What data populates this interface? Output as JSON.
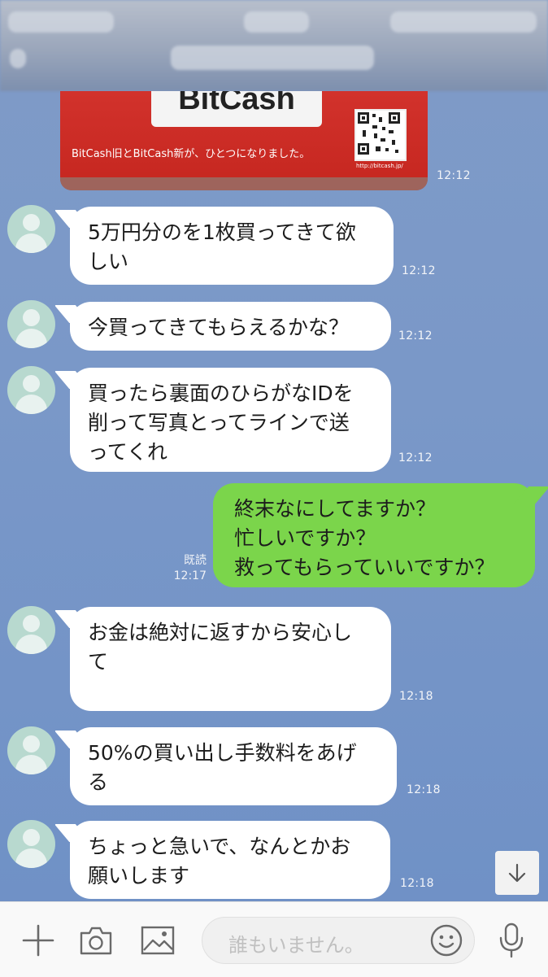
{
  "image_message": {
    "card_title": "BitCash",
    "card_text": "BitCash旧とBitCash新が、ひとつになりました。",
    "qr_caption": "http://bitcash.jp/",
    "time": "12:12"
  },
  "messages": [
    {
      "side": "in",
      "text": "5万円分のを1枚買ってきて欲しい",
      "line1": "5万円分のを1枚買ってきて欲",
      "line2": "しい",
      "time": "12:12"
    },
    {
      "side": "in",
      "text": "今買ってきてもらえるかな？",
      "time": "12:12"
    },
    {
      "side": "in",
      "line1": "買ったら裏面のひらがなIDを",
      "line2": "削って写真とってラインで送",
      "line3": "ってくれ",
      "time": "12:12"
    },
    {
      "side": "out",
      "line1": "終末なにしてますか？",
      "line2": "忙しいですか？",
      "line3": "救ってもらっていいですか？",
      "read": "既読",
      "time": "12:17"
    },
    {
      "side": "in",
      "line1": "お金は絶対に返すから安心し",
      "line2": "て",
      "time": "12:18"
    },
    {
      "side": "in",
      "line1": "50%の買い出し手数料をあげ",
      "line2": "る",
      "time": "12:18"
    },
    {
      "side": "in",
      "line1": "ちょっと急いで、なんとかお",
      "line2": "願いします",
      "time": "12:18"
    }
  ],
  "input": {
    "placeholder": "誰もいません。"
  },
  "icons": [
    "plus-icon",
    "camera-icon",
    "image-icon",
    "emoji-icon",
    "mic-icon",
    "arrow-down-icon"
  ],
  "colors": {
    "background": "#7a98c8",
    "incoming": "#ffffff",
    "outgoing": "#7bd54b"
  }
}
